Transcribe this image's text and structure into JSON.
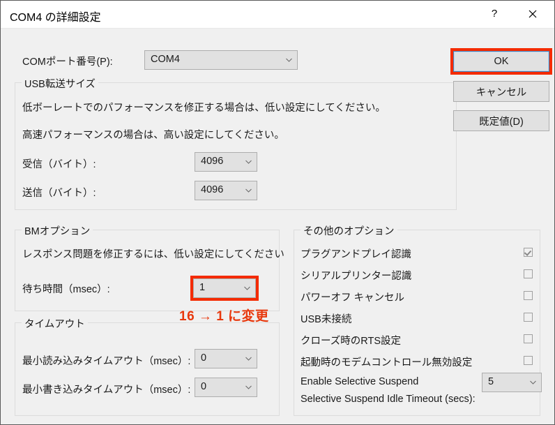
{
  "window": {
    "title": "COM4 の詳細設定",
    "help_icon": "question-mark-icon",
    "close_icon": "close-icon"
  },
  "port": {
    "label": "COMポート番号(P):",
    "value": "COM4"
  },
  "usb_transfer": {
    "group_title": "USB転送サイズ",
    "hint1": "低ボーレートでのパフォーマンスを修正する場合は、低い設定にしてください。",
    "hint2": "高速パフォーマンスの場合は、高い設定にしてください。",
    "receive_label": "受信（バイト）:",
    "receive_value": "4096",
    "transmit_label": "送信（バイト）:",
    "transmit_value": "4096"
  },
  "bm_options": {
    "group_title": "BMオプション",
    "hint": "レスポンス問題を修正するには、低い設定にしてください",
    "latency_label": "待ち時間（msec）:",
    "latency_value": "1"
  },
  "timeouts": {
    "group_title": "タイムアウト",
    "min_read_label": "最小読み込みタイムアウト（msec）:",
    "min_read_value": "0",
    "min_write_label": "最小書き込みタイムアウト（msec）:",
    "min_write_value": "0"
  },
  "misc_options": {
    "group_title": "その他のオプション",
    "items": [
      {
        "label": "プラグアンドプレイ認識",
        "checked": true
      },
      {
        "label": "シリアルプリンター認識",
        "checked": false
      },
      {
        "label": "パワーオフ キャンセル",
        "checked": false
      },
      {
        "label": "USB未接続",
        "checked": false
      },
      {
        "label": "クローズ時のRTS設定",
        "checked": false
      },
      {
        "label": "起動時のモデムコントロール無効設定",
        "checked": false
      },
      {
        "label": "Enable Selective Suspend",
        "checked": false
      }
    ],
    "idle_timeout_label": "Selective Suspend Idle Timeout (secs):",
    "idle_timeout_value": "5"
  },
  "buttons": {
    "ok": "OK",
    "cancel": "キャンセル",
    "defaults": "既定値(D)"
  },
  "annotation": {
    "text": "16 → 1 に変更",
    "color": "#e8380d",
    "highlight_color": "#f42b00"
  }
}
